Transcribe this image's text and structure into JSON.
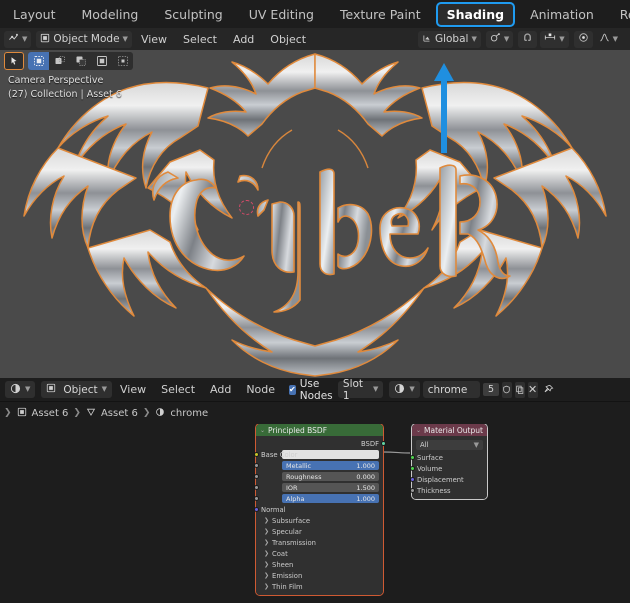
{
  "app": {
    "name": "Blender",
    "theme_accent": "#1f9bf0"
  },
  "topbar": {
    "tabs": [
      {
        "label": "Layout",
        "active": false
      },
      {
        "label": "Modeling",
        "active": false
      },
      {
        "label": "Sculpting",
        "active": false
      },
      {
        "label": "UV Editing",
        "active": false
      },
      {
        "label": "Texture Paint",
        "active": false
      },
      {
        "label": "Shading",
        "active": true
      },
      {
        "label": "Animation",
        "active": false
      },
      {
        "label": "Rendering",
        "active": false
      }
    ]
  },
  "viewport": {
    "header": {
      "editor_type_icon": "editor-type-icon",
      "mode_label": "Object Mode",
      "menus": [
        "View",
        "Select",
        "Add",
        "Object"
      ],
      "transform_orientation": "Global",
      "pivot_icon": "pivot-point-icon",
      "snap_magnet_icon": "snap-magnet-icon",
      "snap_to_icon": "snap-increment-icon",
      "proportional_icon": "proportional-editing-icon",
      "falloff_icon": "proportional-falloff-icon"
    },
    "toolrow": {
      "active_tool_icon": "tweak-tool-icon",
      "select_modes": [
        "set",
        "extend",
        "subtract",
        "invert",
        "intersect"
      ],
      "selected_mode_index": 0
    },
    "info": {
      "line1": "Camera Perspective",
      "line2": "(27) Collection | Asset 6"
    },
    "scene_object_text": "Cyber",
    "annotation": {
      "type": "arrow",
      "color": "#1f8fe0",
      "points_to": "snap-increment-dropdown"
    }
  },
  "shader_editor": {
    "header": {
      "editor_type_icon": "shader-editor-icon",
      "shader_type": "Object",
      "menus": [
        "View",
        "Select",
        "Add",
        "Node"
      ],
      "use_nodes_label": "Use Nodes",
      "use_nodes_checked": true,
      "slot_label": "Slot 1",
      "material_icon": "material-icon",
      "material_name": "chrome",
      "material_users": "5",
      "fake_user_icon": "shield-icon",
      "new_material_icon": "duplicate-icon",
      "unlink_icon": "close-icon",
      "pin_icon": "pin-icon"
    },
    "breadcrumb": [
      {
        "icon": "object-icon",
        "label": "Asset 6"
      },
      {
        "icon": "mesh-data-icon",
        "label": "Asset 6"
      },
      {
        "icon": "material-icon",
        "label": "chrome"
      }
    ],
    "nodes": [
      {
        "name": "Principled BSDF",
        "header_color": "#386b38",
        "outputs": [
          {
            "label": "BSDF",
            "socket": "shader"
          }
        ],
        "inputs": [
          {
            "label": "Base Color",
            "type": "color",
            "socket": "yellow",
            "value": ""
          },
          {
            "label": "Metallic",
            "type": "slider",
            "socket": "gray",
            "value": "1.000",
            "highlight": true
          },
          {
            "label": "Roughness",
            "type": "slider",
            "socket": "gray",
            "value": "0.000",
            "highlight": false
          },
          {
            "label": "IOR",
            "type": "slider",
            "socket": "gray",
            "value": "1.500",
            "highlight": false
          },
          {
            "label": "Alpha",
            "type": "slider",
            "socket": "gray",
            "value": "1.000",
            "highlight": true
          },
          {
            "label": "Normal",
            "type": "socket-only",
            "socket": "purple",
            "value": ""
          }
        ],
        "panels": [
          "Subsurface",
          "Specular",
          "Transmission",
          "Coat",
          "Sheen",
          "Emission",
          "Thin Film"
        ]
      },
      {
        "name": "Material Output",
        "header_color": "#6b3a4a",
        "target_dropdown": "All",
        "inputs": [
          {
            "label": "Surface",
            "socket": "green"
          },
          {
            "label": "Volume",
            "socket": "green"
          },
          {
            "label": "Displacement",
            "socket": "purple"
          },
          {
            "label": "Thickness",
            "socket": "gray"
          }
        ]
      }
    ]
  }
}
